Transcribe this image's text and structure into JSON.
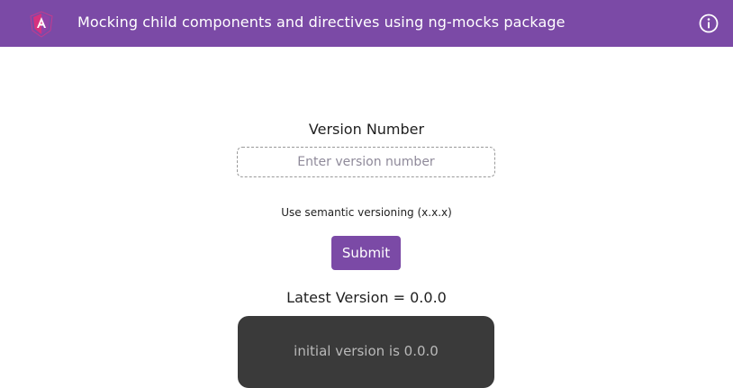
{
  "header": {
    "title": "Mocking child components and directives using ng-mocks package",
    "logo_icon": "angular-logo-icon",
    "info_icon": "info-icon",
    "background_color": "#7b4aa6"
  },
  "form": {
    "label": "Version Number",
    "input_placeholder": "Enter version number",
    "input_value": "",
    "hint": "Use semantic versioning (x.x.x)",
    "submit_label": "Submit"
  },
  "result": {
    "latest_version_text": "Latest Version = 0.0.0"
  },
  "child_component": {
    "text": "initial version is 0.0.0",
    "background_color": "#3a3a3a"
  }
}
